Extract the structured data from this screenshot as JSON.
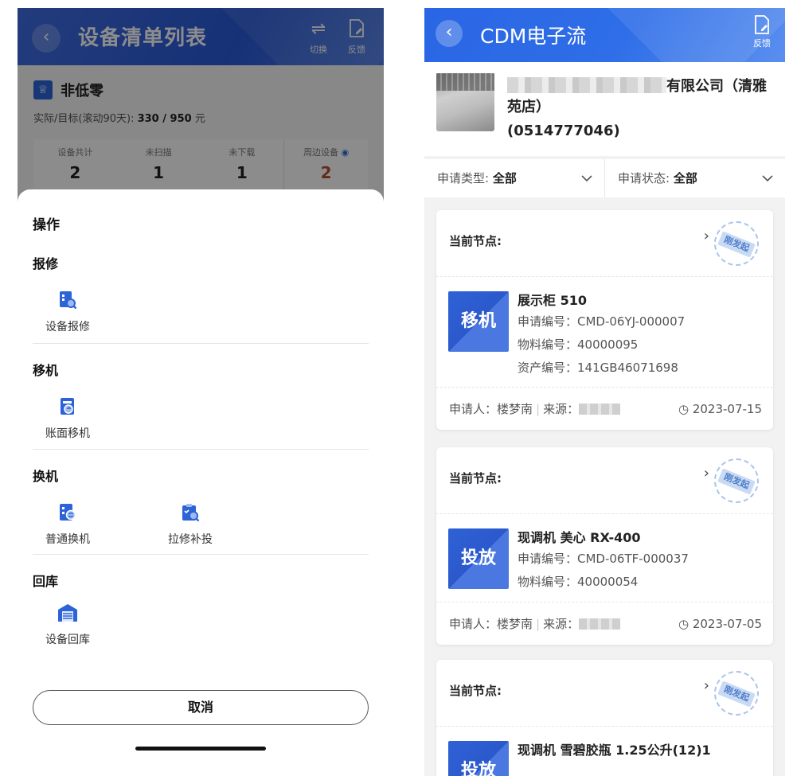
{
  "left": {
    "header": {
      "title": "设备清单列表",
      "switch_label": "切换",
      "feedback_label": "反馈"
    },
    "summary": {
      "title": "非低零",
      "target_label": "实际/目标(滚动90天):",
      "target_value": "330 / 950",
      "target_unit": "元",
      "stats": [
        {
          "label": "设备共计",
          "value": "2"
        },
        {
          "label": "未扫描",
          "value": "1"
        },
        {
          "label": "未下载",
          "value": "1"
        },
        {
          "label": "周边设备",
          "value": "2"
        }
      ]
    },
    "sheet": {
      "title": "操作",
      "groups": [
        {
          "title": "报修",
          "items": [
            {
              "label": "设备报修"
            }
          ]
        },
        {
          "title": "移机",
          "items": [
            {
              "label": "账面移机"
            }
          ]
        },
        {
          "title": "换机",
          "items": [
            {
              "label": "普通换机"
            },
            {
              "label": "拉修补投"
            }
          ]
        },
        {
          "title": "回库",
          "items": [
            {
              "label": "设备回库"
            }
          ]
        }
      ],
      "cancel_label": "取消"
    }
  },
  "right": {
    "header": {
      "title": "CDM电子流",
      "feedback_label": "反馈"
    },
    "store": {
      "name_suffix": "有限公司（清雅苑店）",
      "phone": "(0514777046)"
    },
    "filters": [
      {
        "label": "申请类型:",
        "value": "全部"
      },
      {
        "label": "申请状态:",
        "value": "全部"
      }
    ],
    "cards": [
      {
        "node_label": "当前节点:",
        "stamp": "刚发起",
        "type_tag": "移机",
        "name": "展示柜 510",
        "lines": [
          "申请编号：CMD-06YJ-000007",
          "物料编号：40000095",
          "资产编号：141GB46071698"
        ],
        "applicant": "申请人：楼梦南",
        "source": "来源：",
        "date": "2023-07-15"
      },
      {
        "node_label": "当前节点:",
        "stamp": "刚发起",
        "type_tag": "投放",
        "name": "现调机 美心 RX-400",
        "lines": [
          "申请编号：CMD-06TF-000037",
          "物料编号：40000054"
        ],
        "applicant": "申请人：楼梦南",
        "source": "来源：",
        "date": "2023-07-05"
      },
      {
        "node_label": "当前节点:",
        "stamp": "刚发起",
        "type_tag": "投放",
        "name": "现调机 雪碧胶瓶 1.25公升(12)1",
        "lines": []
      }
    ]
  },
  "colors": {
    "brand_blue": "#2c64d8",
    "stat_highlight": "#b84b32",
    "stamp_blue": "#7aa0dc"
  },
  "icons": {
    "back": "chevron-left-icon",
    "switch": "swap-arrows-icon",
    "feedback": "document-edit-icon",
    "repair": "device-search-icon",
    "move": "ledger-move-icon",
    "swap": "device-swap-icon",
    "refill": "clipboard-search-icon",
    "return": "warehouse-icon",
    "clock": "clock-icon",
    "chevron_down": "chevron-down-icon",
    "chevron_right": "chevron-right-icon"
  }
}
